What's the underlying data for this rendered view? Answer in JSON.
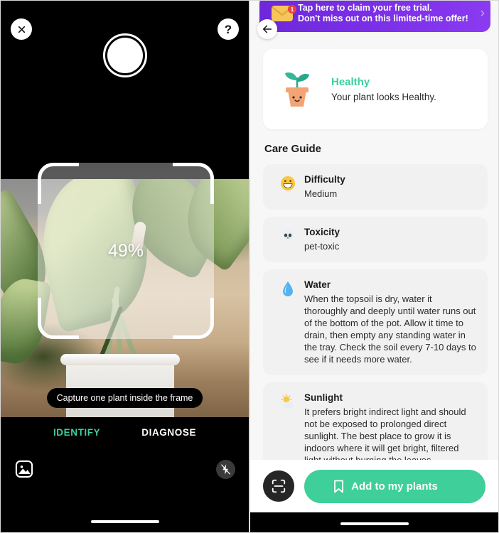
{
  "camera": {
    "close_icon": "close-icon",
    "help_label": "?",
    "scan_percent": "49%",
    "hint": "Capture one plant inside the frame",
    "tabs": [
      {
        "label": "IDENTIFY",
        "active": true
      },
      {
        "label": "DIAGNOSE",
        "active": false
      }
    ],
    "gallery_icon": "gallery-icon",
    "flash_icon": "flash-off-icon",
    "shutter_icon": "shutter-button"
  },
  "result": {
    "promo": {
      "line1": "Tap here to claim your free trial.",
      "line2": "Don't miss out on this limited-time offer!",
      "badge": "1",
      "chevron": "›",
      "icon": "envelope-icon",
      "color": "#7c30e8"
    },
    "back_icon": "back-arrow-icon",
    "health": {
      "icon": "potted-seedling-icon",
      "status": "Healthy",
      "message": "Your plant looks Healthy.",
      "accent": "#3ECF9B"
    },
    "care_guide_heading": "Care Guide",
    "care_items": [
      {
        "icon": "grinning-face-emoji",
        "title": "Difficulty",
        "description": "Medium"
      },
      {
        "icon": "skull-emoji",
        "title": "Toxicity",
        "description": "pet-toxic"
      },
      {
        "icon": "water-drop-emoji",
        "title": "Water",
        "description": "When the topsoil is dry, water it thoroughly and deeply until water runs out of the bottom of the pot. Allow it time to drain, then empty any standing water in the tray. Check the soil every 7-10 days to see if it needs more water."
      },
      {
        "icon": "sun-behind-cloud-emoji",
        "title": "Sunlight",
        "description": "It prefers bright indirect light and should not be exposed to prolonged direct sunlight. The best place to grow it is indoors where it will get bright, filtered light without burning the leaves."
      }
    ],
    "scan_icon": "scan-frame-icon",
    "add_button": {
      "label": "Add to my plants",
      "icon": "bookmark-icon",
      "color": "#3ECF9B"
    }
  }
}
